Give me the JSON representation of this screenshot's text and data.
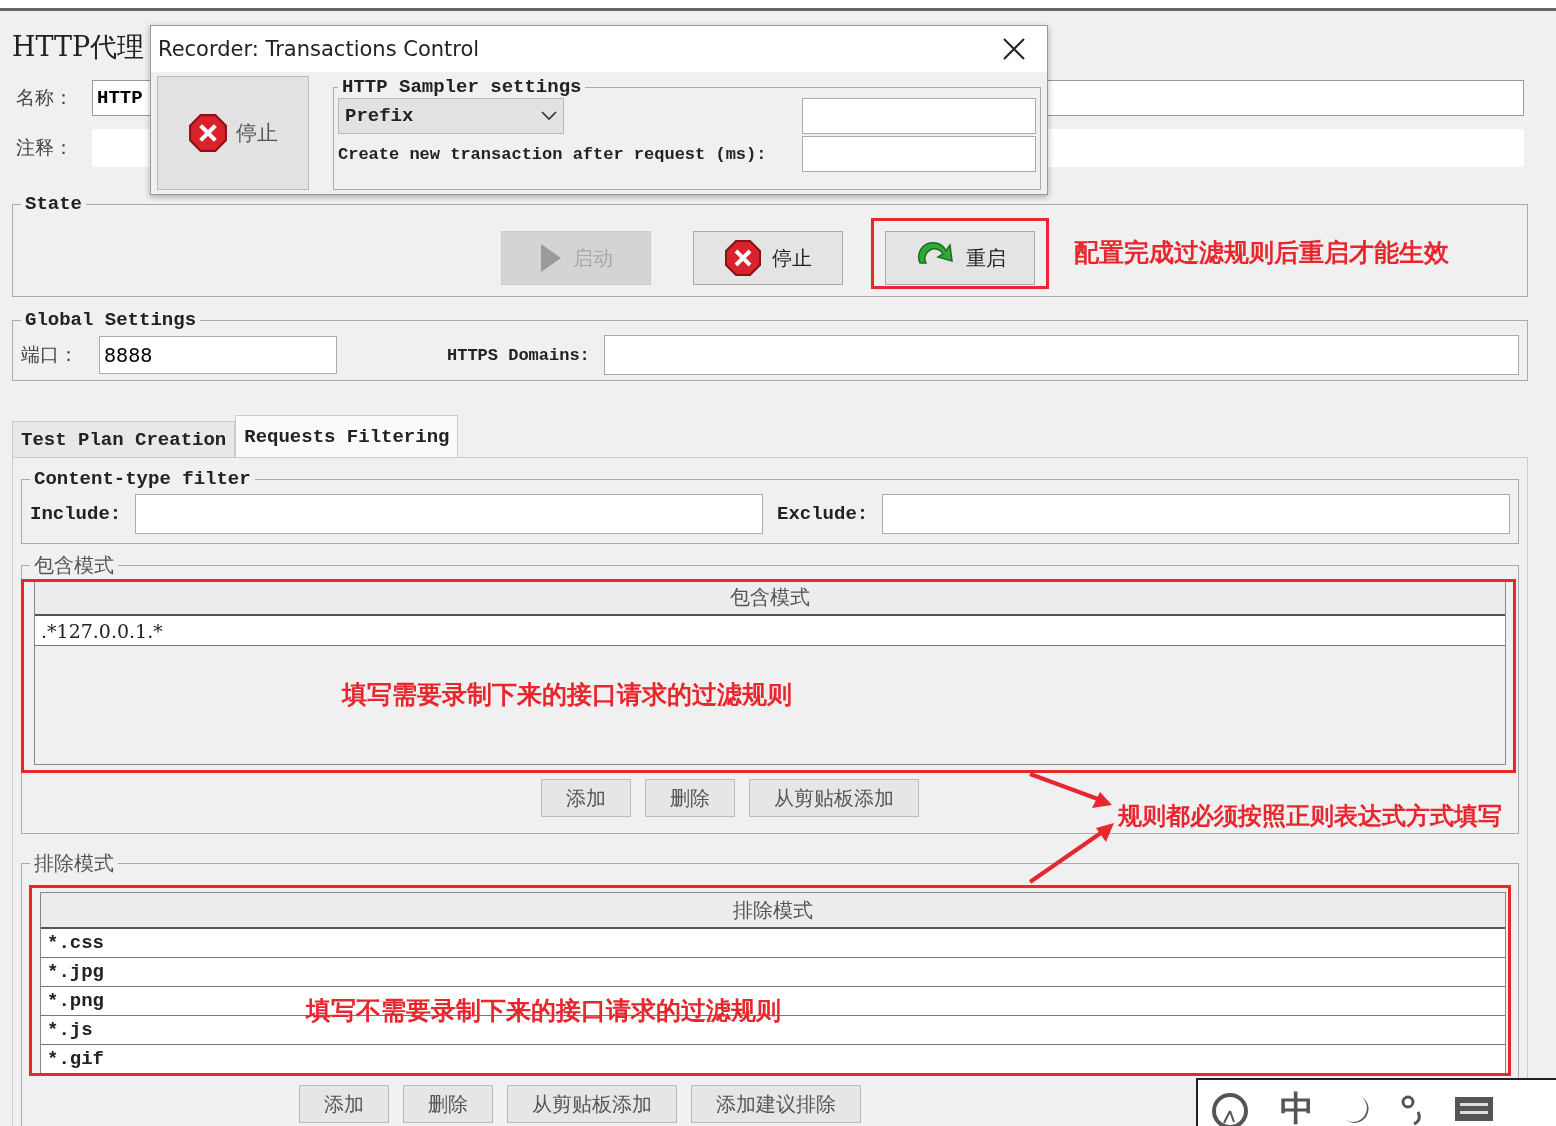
{
  "title": "HTTP代理",
  "form": {
    "fields": [
      {
        "label": "名称：",
        "value": "HTTP"
      },
      {
        "label": "注释："
      }
    ]
  },
  "dialog": {
    "title": "Recorder: Transactions Control",
    "stop_button": "停止",
    "group": "HTTP Sampler settings",
    "dropdown": "Prefix",
    "transaction_label": "Create new transaction after request (ms):"
  },
  "state": {
    "title": "State",
    "buttons": [
      {
        "label": "启动",
        "kind": "start",
        "disabled": true
      },
      {
        "label": "停止",
        "kind": "stop",
        "disabled": false
      },
      {
        "label": "重启",
        "kind": "restart",
        "disabled": false
      }
    ]
  },
  "global": {
    "title": "Global Settings",
    "port_label": "端口：",
    "port": "8888",
    "https_label": "HTTPS Domains:"
  },
  "tabs": [
    {
      "label": "Test Plan Creation",
      "selected": false
    },
    {
      "label": "Requests Filtering",
      "selected": true
    }
  ],
  "content_filter": {
    "title": "Content-type filter",
    "include_label": "Include:",
    "exclude_label": "Exclude:"
  },
  "include": {
    "title": "包含模式",
    "header": "包含模式",
    "rows": [
      ".*127.0.0.1.*"
    ],
    "buttons": [
      "添加",
      "删除",
      "从剪贴板添加"
    ]
  },
  "exclude": {
    "title": "排除模式",
    "header": "排除模式",
    "rows": [
      "*.css",
      "*.jpg",
      "*.png",
      "*.js",
      "*.gif"
    ],
    "buttons": [
      "添加",
      "删除",
      "从剪贴板添加",
      "添加建议排除"
    ]
  },
  "annotations": {
    "restart": "配置完成过滤规则后重启才能生效",
    "include": "填写需要录制下来的接口请求的过滤规则",
    "regex": "规则都必须按照正则表达式方式填写",
    "exclude": "填写不需要录制下来的接口请求的过滤规则"
  },
  "ime": {
    "mode": "中"
  }
}
